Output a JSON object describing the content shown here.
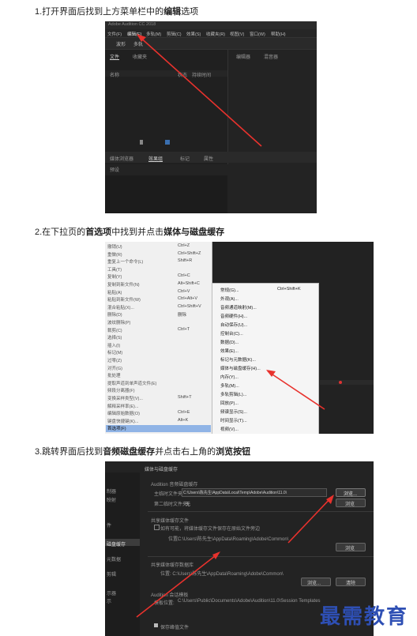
{
  "steps": [
    {
      "text": "1.打开界面后找到上方菜单栏中的",
      "bold": "编辑",
      "suffix": "选项"
    },
    {
      "text": "2.在下拉页的",
      "bold": "首选项",
      "mid": "中找到并点击",
      "bold2": "媒体与磁盘缓存",
      "suffix": ""
    },
    {
      "text": "3.跳转界面后找到",
      "bold": "音频磁盘缓存",
      "mid": "并点击右上角的",
      "bold2": "浏览按钮",
      "suffix": ""
    }
  ],
  "shot1": {
    "app_title": "Adobe Audition CC 2018",
    "menubar": [
      "文件(F)",
      "编辑(E)",
      "多轨(M)",
      "剪辑(C)",
      "效果(S)",
      "收藏夹(R)",
      "视图(V)",
      "窗口(W)",
      "帮助(H)"
    ],
    "toolbar_left": [
      "波形",
      "多轨"
    ],
    "panel_tabs": [
      "文件",
      "收藏夹"
    ],
    "panel_right_tabs": [
      "编辑器",
      "混音器"
    ],
    "columns": [
      "名称",
      "状态",
      "持续时间"
    ],
    "bottom_tabs": [
      "媒体浏览器",
      "效果组",
      "标记",
      "属性"
    ],
    "bottom_preset": "预设"
  },
  "shot2": {
    "menu": [
      {
        "label": "撤销(U)",
        "key": "Ctrl+Z"
      },
      {
        "label": "重做(R)",
        "key": "Ctrl+Shift+Z"
      },
      {
        "label": "重复上一个命令(L)",
        "key": "Shift+R"
      },
      {
        "label": "工具(T)",
        "key": ""
      },
      {
        "label": "复制(Y)",
        "key": "Ctrl+C"
      },
      {
        "label": "复制到新文件(N)",
        "key": "Alt+Shift+C"
      },
      {
        "label": "粘贴(A)",
        "key": "Ctrl+V"
      },
      {
        "label": "粘贴到新文件(W)",
        "key": "Ctrl+Alt+V"
      },
      {
        "label": "混合粘贴(X)...",
        "key": "Ctrl+Shift+V"
      },
      {
        "label": "删除(D)",
        "key": "删除"
      },
      {
        "label": "波纹删除(P)",
        "key": ""
      },
      {
        "label": "裁剪(C)",
        "key": "Ctrl+T"
      },
      {
        "label": "选择(S)",
        "key": ""
      },
      {
        "label": "插入(I)",
        "key": ""
      },
      {
        "label": "标记(M)",
        "key": ""
      },
      {
        "label": "过零(Z)",
        "key": ""
      },
      {
        "label": "对齐(G)",
        "key": ""
      },
      {
        "label": "批处理",
        "key": ""
      },
      {
        "label": "提取声道到单声道文件(E)",
        "key": ""
      },
      {
        "label": "频段分离器(F)",
        "key": ""
      },
      {
        "label": "变换采样类型(V)...",
        "key": "Shift+T"
      },
      {
        "label": "解释采样率(E)...",
        "key": ""
      },
      {
        "label": "编辑原始数据(O)",
        "key": "Ctrl+E"
      },
      {
        "label": "键盘快捷键(K)...",
        "key": "Alt+K"
      },
      {
        "label": "首选项(F)",
        "key": ""
      }
    ],
    "submenu": [
      {
        "label": "常规(G)...",
        "key": "Ctrl+Shift+K"
      },
      {
        "label": "外观(A)...",
        "key": ""
      },
      {
        "label": "音频通道映射(M)...",
        "key": ""
      },
      {
        "label": "音频硬件(H)...",
        "key": ""
      },
      {
        "label": "自动保存(U)...",
        "key": ""
      },
      {
        "label": "控制台(C)...",
        "key": ""
      },
      {
        "label": "数据(D)...",
        "key": ""
      },
      {
        "label": "效果(E)...",
        "key": ""
      },
      {
        "label": "标记与元数据(K)...",
        "key": ""
      },
      {
        "label": "媒体与磁盘缓存(H)...",
        "key": ""
      },
      {
        "label": "内存(Y)...",
        "key": ""
      },
      {
        "label": "多轨(M)...",
        "key": ""
      },
      {
        "label": "多轨剪辑(L)...",
        "key": ""
      },
      {
        "label": "回放(P)...",
        "key": ""
      },
      {
        "label": "频谱显示(S)...",
        "key": ""
      },
      {
        "label": "时间显示(T)...",
        "key": ""
      },
      {
        "label": "视频(V)...",
        "key": ""
      }
    ]
  },
  "shot3": {
    "header": "媒体与磁盘缓存",
    "left_items": [
      "制器",
      "映射",
      "件",
      "磁盘缓存",
      "元数据",
      "剪辑",
      "示器",
      "示"
    ],
    "section1": "Audition 音频磁盘缓存",
    "temp_label": "主临时文件夹:",
    "temp_value": "C:\\Users\\陈先生\\AppData\\Local\\Temp\\Adobe\\Audition\\11.0\\",
    "second_label": "第二临时文件夹:",
    "second_value": "无",
    "browse1": "浏览...",
    "browse2": "浏览",
    "section2": "共享媒体缓存文件",
    "checkbox1": "如有可能，将媒体缓存文件保存在原始文件旁边",
    "location_label": "位置:",
    "location_value": "C:\\Users\\陈先生\\AppData\\Roaming\\Adobe\\Common\\",
    "browse3": "浏览",
    "section3": "共享媒体缓存数据库",
    "db_value": "位置: C:\\Users\\陈先生\\AppData\\Roaming\\Adobe\\Common\\",
    "browse4": "浏览...",
    "clean": "清除",
    "section4": "Audition 会话模板",
    "template_label": "模板位置:",
    "template_value": "C:\\Users\\Public\\Documents\\Adobe\\Audition\\11.0\\Session Templates",
    "checkbox2": "保存峰值文件"
  },
  "watermark": "最需教育"
}
